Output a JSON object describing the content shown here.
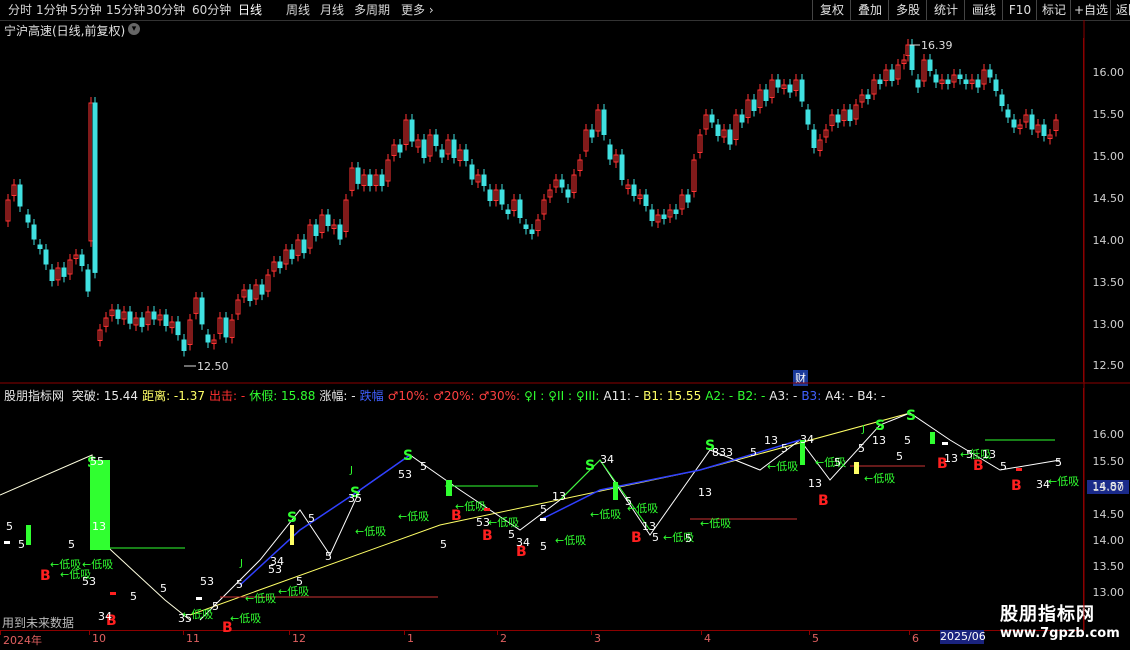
{
  "toolbar": {
    "periods": [
      "分时",
      "1分钟",
      "5分钟",
      "15分钟",
      "30分钟",
      "60分钟",
      "日线",
      "周线",
      "月线",
      "多周期",
      "更多"
    ],
    "active_period": "日线",
    "right_buttons": [
      "复权",
      "叠加",
      "多股",
      "统计",
      "画线",
      "F10",
      "标记",
      "+自选",
      "返回"
    ]
  },
  "main_chart": {
    "title": "宁沪高速(日线,前复权)",
    "high_label": "16.39",
    "low_label": "12.50",
    "price_ticks": [
      "16.00",
      "15.50",
      "15.00",
      "14.50",
      "14.00",
      "13.50",
      "13.00",
      "12.50"
    ],
    "marker": "财"
  },
  "indicator": {
    "name": "股朋指标网",
    "fields": [
      {
        "text": "突破: 15.44",
        "color": "#e8e8e8"
      },
      {
        "text": "距离: -1.37",
        "color": "#ffff66"
      },
      {
        "text": "出击: -",
        "color": "#ff3030"
      },
      {
        "text": "休假: 15.88",
        "color": "#30ff30"
      },
      {
        "text": "涨幅: -",
        "color": "#e8e8e8"
      },
      {
        "text": "跌幅",
        "color": "#4060ff"
      },
      {
        "text": "♂10%:",
        "color": "#ff4040"
      },
      {
        "text": "♂20%:",
        "color": "#ff4040"
      },
      {
        "text": "♂30%:",
        "color": "#ff4040"
      },
      {
        "text": "♀I :",
        "color": "#30ff30"
      },
      {
        "text": "♀II :",
        "color": "#30ff30"
      },
      {
        "text": "♀III:",
        "color": "#30ff30"
      },
      {
        "text": "A11: -",
        "color": "#e8e8e8"
      },
      {
        "text": "B1: 15.55",
        "color": "#ffff66"
      },
      {
        "text": "A2: -",
        "color": "#30ff30"
      },
      {
        "text": "B2: -",
        "color": "#30ff30"
      },
      {
        "text": "A3: -",
        "color": "#e8e8e8"
      },
      {
        "text": "B3:",
        "color": "#4060ff"
      },
      {
        "text": "A4: -",
        "color": "#e8e8e8"
      },
      {
        "text": "B4: -",
        "color": "#e8e8e8"
      }
    ],
    "value_ticks": [
      "16.00",
      "15.50",
      "15.00",
      "14.50",
      "14.00",
      "13.50",
      "13.00"
    ],
    "current_tag": "14.87",
    "buy_label": "B",
    "sell_label": "S",
    "dip_label": "低吸",
    "j_label": "J",
    "number_labels": [
      "5",
      "34",
      "13",
      "53",
      "35",
      "55",
      "833",
      "3",
      "4"
    ]
  },
  "dates": [
    "2024年",
    "10",
    "11",
    "12",
    "1",
    "2",
    "3",
    "4",
    "5",
    "6"
  ],
  "date_box": "2025/06",
  "future_note": "用到未来数据",
  "watermark": {
    "name": "股朋指标网",
    "url": "www.7gpzb.com"
  },
  "colors": {
    "up": "#ff3333",
    "down": "#40e0e0",
    "grid": "#8b0000",
    "yellow": "#ffff66",
    "green": "#30ff30",
    "blue": "#3040ff"
  }
}
